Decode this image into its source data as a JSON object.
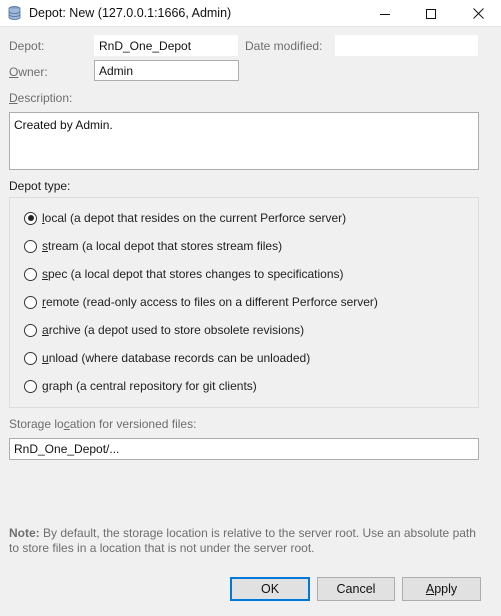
{
  "window": {
    "title": "Depot: New (127.0.0.1:1666,  Admin)"
  },
  "form": {
    "depot_label": "Depot:",
    "depot_value": "RnD_One_Depot",
    "date_modified_label": "Date modified:",
    "date_modified_value": "",
    "owner_label_underlined": "O",
    "owner_label_rest": "wner:",
    "owner_value": "Admin",
    "description_label_underlined": "D",
    "description_label_rest": "escription:",
    "description_value": "Created by Admin.",
    "depot_type_label": "Depot type:",
    "storage_label_pre": "Storage lo",
    "storage_label_underlined": "c",
    "storage_label_post": "ation for versioned files:",
    "storage_value": "RnD_One_Depot/..."
  },
  "depot_types": [
    {
      "key": "l",
      "rest": "ocal (a depot that resides on the current Perforce server)",
      "checked": true
    },
    {
      "key": "s",
      "rest": "tream (a local depot that stores stream files)",
      "checked": false
    },
    {
      "key": "s",
      "rest": "pec (a local depot that stores changes to specifications)",
      "checked": false
    },
    {
      "key": "r",
      "rest": "emote (read-only access to files on a different Perforce server)",
      "checked": false
    },
    {
      "key": "a",
      "rest": "rchive (a depot used to store obsolete revisions)",
      "checked": false
    },
    {
      "key": "u",
      "rest": "nload (where database records can be unloaded)",
      "checked": false
    },
    {
      "key": "g",
      "rest": "raph (a central repository for git clients)",
      "checked": false
    }
  ],
  "note": {
    "bold": "Note:",
    "text": " By default, the storage location is relative to the server root. Use an absolute path to store files in a location that is not under the server root."
  },
  "buttons": {
    "ok": "OK",
    "cancel": "Cancel",
    "apply_underlined": "A",
    "apply_rest": "pply"
  },
  "icons": {
    "title": "database-icon",
    "minimize": "minimize-icon",
    "maximize": "maximize-icon",
    "close": "close-icon"
  },
  "colors": {
    "accent": "#0078d7",
    "window_bg": "#f0f0f0"
  }
}
